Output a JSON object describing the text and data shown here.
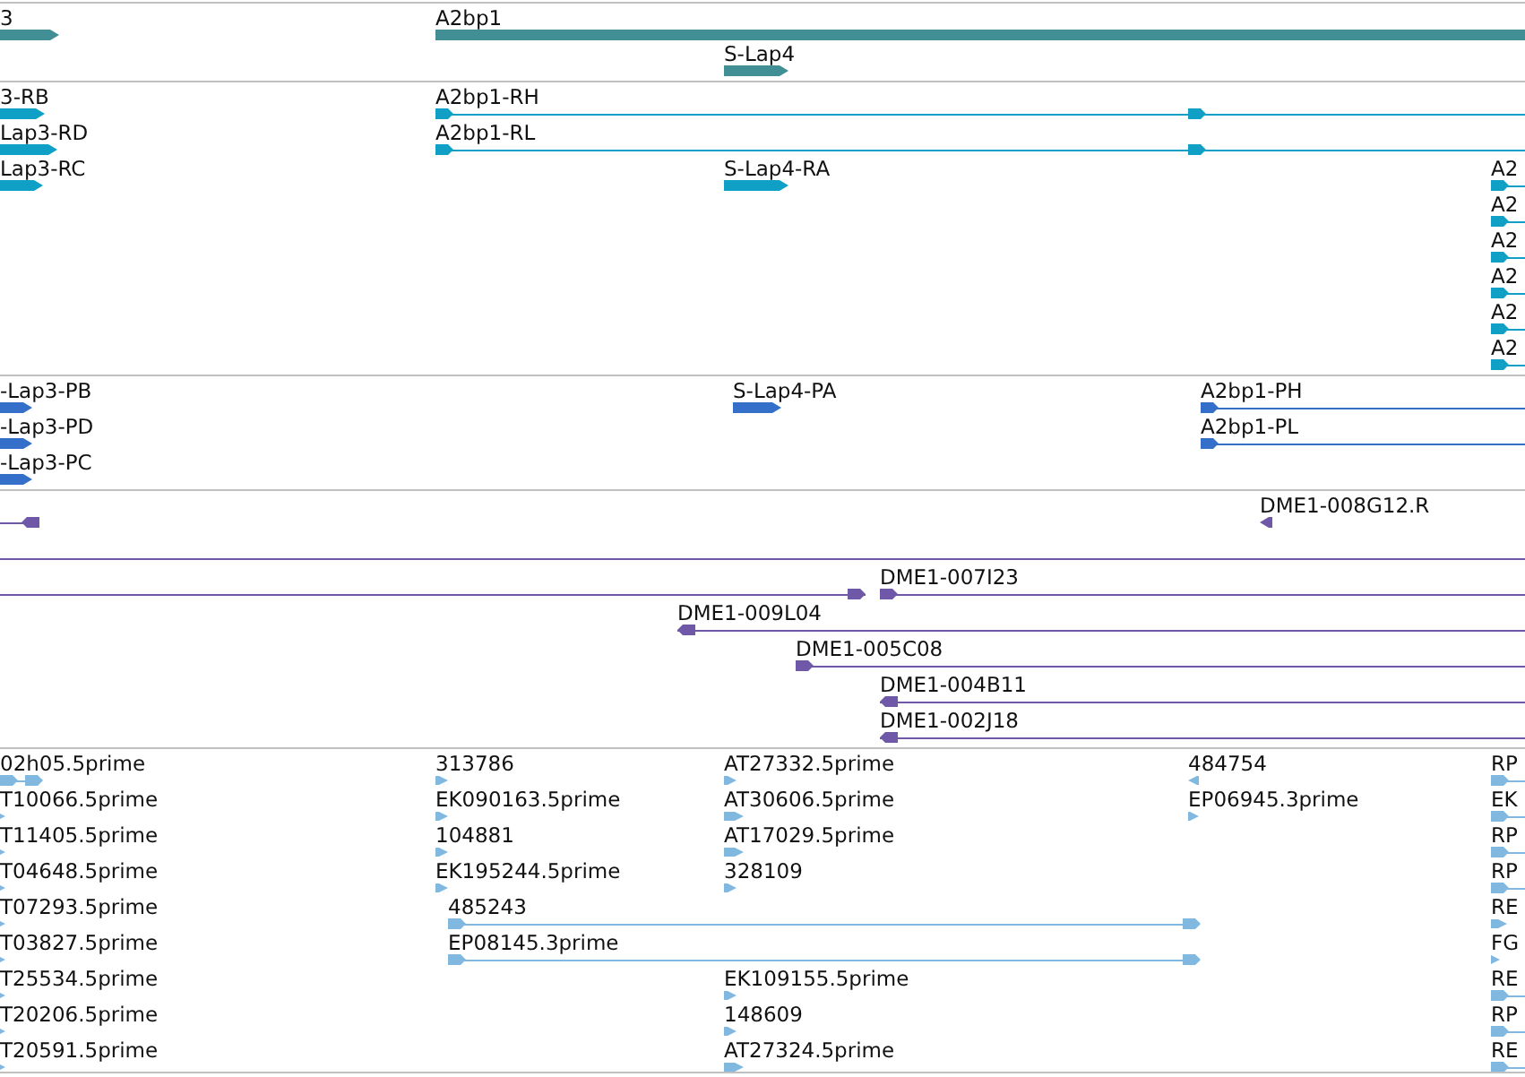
{
  "tracks": [
    {
      "kind": "gene",
      "color": "#418f94",
      "features": [
        {
          "label": "3",
          "reverse": false
        },
        {
          "label": "A2bp1"
        },
        {
          "label": "S-Lap4",
          "reverse": false
        }
      ]
    },
    {
      "kind": "transcript",
      "color": "#109fc5",
      "features": [
        {
          "label": "3-RB",
          "reverse": false
        },
        {
          "label": "Lap3-RD",
          "reverse": false
        },
        {
          "label": "Lap3-RC",
          "reverse": false
        },
        {
          "label": "A2bp1-RH",
          "reverse": false
        },
        {
          "label": "A2bp1-RL",
          "reverse": false
        },
        {
          "label": "S-Lap4-RA",
          "reverse": false
        },
        {
          "label": "A2",
          "reverse": false
        },
        {
          "label": "A2",
          "reverse": false
        },
        {
          "label": "A2",
          "reverse": false
        },
        {
          "label": "A2",
          "reverse": false
        },
        {
          "label": "A2",
          "reverse": false
        },
        {
          "label": "A2",
          "reverse": false
        }
      ]
    },
    {
      "kind": "protein",
      "color": "#3470c9",
      "features": [
        {
          "label": "-Lap3-PB",
          "reverse": false
        },
        {
          "label": "-Lap3-PD",
          "reverse": false
        },
        {
          "label": "-Lap3-PC",
          "reverse": false
        },
        {
          "label": "S-Lap4-PA",
          "reverse": false
        },
        {
          "label": "A2bp1-PH",
          "reverse": false
        },
        {
          "label": "A2bp1-PL",
          "reverse": false
        }
      ]
    },
    {
      "kind": "clone",
      "color": "#7058a8",
      "features": [
        {
          "kind": "line",
          "reverse": true
        },
        {
          "kind": "bar",
          "label": "DME1-008G12.R",
          "reverse": true
        },
        {
          "kind": "line"
        },
        {
          "kind": "line",
          "reverse": false
        },
        {
          "kind": "line",
          "label": "DME1-007I23",
          "reverse": false
        },
        {
          "kind": "line",
          "label": "DME1-009L04",
          "reverse": true
        },
        {
          "kind": "line",
          "label": "DME1-005C08",
          "reverse": false
        },
        {
          "kind": "line",
          "label": "DME1-004B11",
          "reverse": true
        },
        {
          "kind": "line",
          "label": "DME1-002J18",
          "reverse": true
        }
      ]
    },
    {
      "kind": "est",
      "color": "#80b8e0",
      "features": [
        {
          "label": "02h05.5prime",
          "reverse": false
        },
        {
          "label": "T10066.5prime",
          "reverse": false
        },
        {
          "label": "T11405.5prime",
          "reverse": false
        },
        {
          "label": "T04648.5prime",
          "reverse": false
        },
        {
          "label": "T07293.5prime",
          "reverse": false
        },
        {
          "label": "T03827.5prime",
          "reverse": false
        },
        {
          "label": "T25534.5prime",
          "reverse": false
        },
        {
          "label": "T20206.5prime",
          "reverse": false
        },
        {
          "label": "T20591.5prime",
          "reverse": false
        },
        {
          "label": "313786",
          "reverse": false
        },
        {
          "label": "EK090163.5prime",
          "reverse": false
        },
        {
          "label": "104881",
          "reverse": false
        },
        {
          "label": "EK195244.5prime",
          "reverse": false
        },
        {
          "label": "485243",
          "reverse": false
        },
        {
          "label": "EP08145.3prime",
          "reverse": false
        },
        {
          "label": "AT27332.5prime",
          "reverse": false
        },
        {
          "label": "AT30606.5prime",
          "reverse": false
        },
        {
          "label": "AT17029.5prime",
          "reverse": false
        },
        {
          "label": "328109",
          "reverse": false
        },
        {
          "label": "EK109155.5prime",
          "reverse": false
        },
        {
          "label": "148609",
          "reverse": false
        },
        {
          "label": "AT27324.5prime",
          "reverse": false
        },
        {
          "label": "484754",
          "reverse": true
        },
        {
          "label": "EP06945.3prime",
          "reverse": false
        },
        {
          "label": "RP",
          "reverse": false
        },
        {
          "label": "EK",
          "reverse": false
        },
        {
          "label": "RP",
          "reverse": false
        },
        {
          "label": "RP",
          "reverse": false
        },
        {
          "label": "RE",
          "reverse": false
        },
        {
          "label": "FG",
          "reverse": false
        },
        {
          "label": "RE",
          "reverse": false
        },
        {
          "label": "RP",
          "reverse": false
        },
        {
          "label": "RE",
          "reverse": false
        }
      ]
    }
  ]
}
